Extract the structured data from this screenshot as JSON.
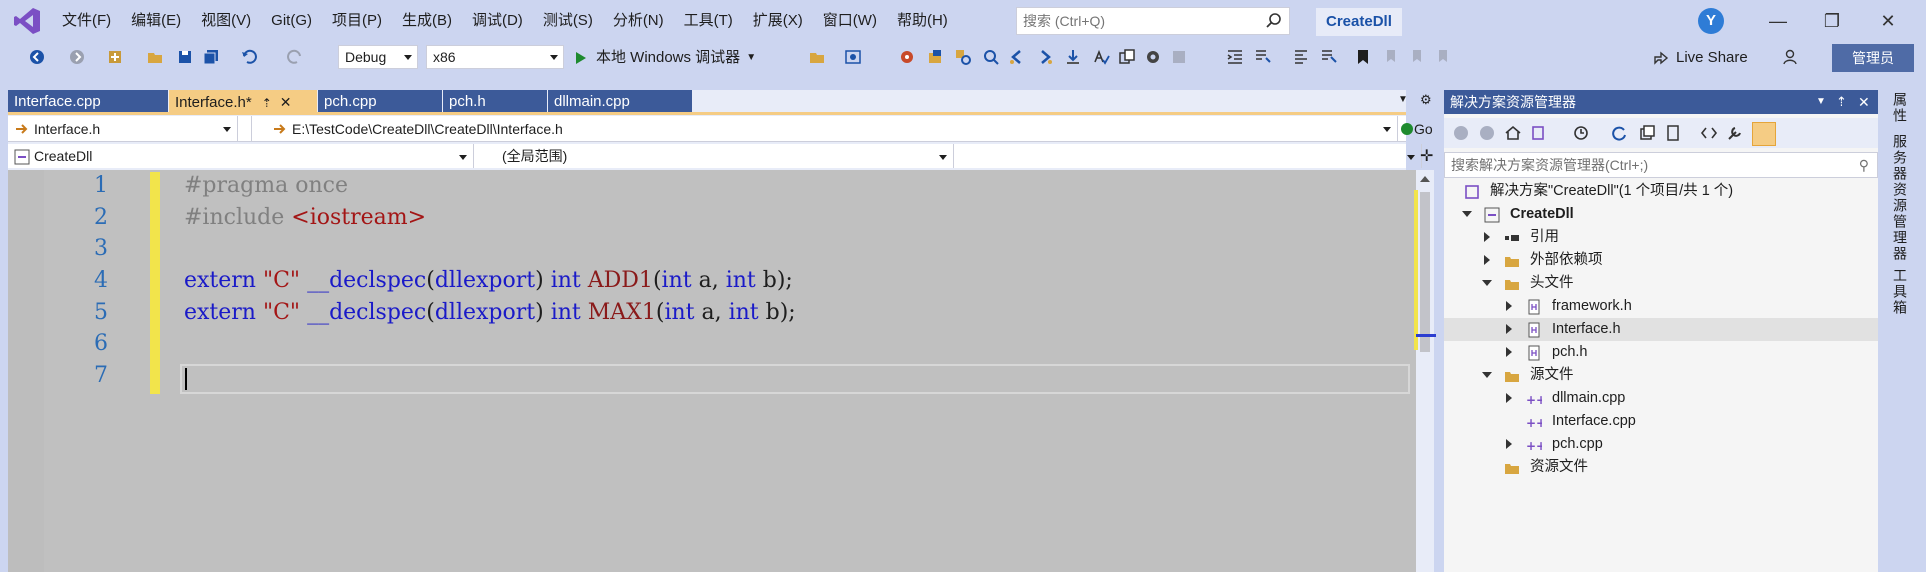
{
  "menu": [
    "文件(F)",
    "编辑(E)",
    "视图(V)",
    "Git(G)",
    "项目(P)",
    "生成(B)",
    "调试(D)",
    "测试(S)",
    "分析(N)",
    "工具(T)",
    "扩展(X)",
    "窗口(W)",
    "帮助(H)"
  ],
  "search": {
    "placeholder": "搜索 (Ctrl+Q)"
  },
  "solution_title": "CreateDll",
  "avatar_letter": "Y",
  "toolbar": {
    "config": "Debug",
    "platform": "x86",
    "debugger": "本地 Windows 调试器",
    "live_share": "Live Share",
    "admin": "管理员"
  },
  "tabs": [
    {
      "label": "Interface.cpp",
      "active": false
    },
    {
      "label": "Interface.h*",
      "active": true
    },
    {
      "label": "pch.cpp",
      "active": false
    },
    {
      "label": "pch.h",
      "active": false
    },
    {
      "label": "dllmain.cpp",
      "active": false
    }
  ],
  "nav": {
    "file": "Interface.h",
    "path": "E:\\TestCode\\CreateDll\\CreateDll\\Interface.h",
    "go": "Go",
    "project": "CreateDll",
    "scope": "(全局范围)"
  },
  "code": {
    "line_numbers": [
      "1",
      "2",
      "3",
      "4",
      "5",
      "6",
      "7"
    ],
    "line1": "#pragma once",
    "line2_pp": "#include",
    "line2_hdr": "<iostream>",
    "line4": {
      "kw1": "extern",
      "str": "\"C\"",
      "kw2": "__declspec",
      "p1": "(",
      "arg": "dllexport",
      "p2": ")",
      "kw3": "int",
      "fn": "ADD1",
      "p3": "(",
      "kw4": "int",
      "a": "a,",
      "kw5": "int",
      "b": "b);"
    },
    "line5": {
      "kw1": "extern",
      "str": "\"C\"",
      "kw2": "__declspec",
      "p1": "(",
      "arg": "dllexport",
      "p2": ")",
      "kw3": "int",
      "fn": "MAX1",
      "p3": "(",
      "kw4": "int",
      "a": "a,",
      "kw5": "int",
      "b": "b);"
    }
  },
  "solution_explorer": {
    "title": "解决方案资源管理器",
    "search_placeholder": "搜索解决方案资源管理器(Ctrl+;)",
    "items": [
      {
        "label": "解决方案\"CreateDll\"(1 个项目/共 1 个)"
      },
      {
        "label": "CreateDll"
      },
      {
        "label": "引用"
      },
      {
        "label": "外部依赖项"
      },
      {
        "label": "头文件"
      },
      {
        "label": "framework.h"
      },
      {
        "label": "Interface.h"
      },
      {
        "label": "pch.h"
      },
      {
        "label": "源文件"
      },
      {
        "label": "dllmain.cpp"
      },
      {
        "label": "Interface.cpp"
      },
      {
        "label": "pch.cpp"
      },
      {
        "label": "资源文件"
      }
    ]
  },
  "rail": [
    "属性",
    "服务器资源管理器",
    "工具箱"
  ],
  "colors": {
    "accent": "#3C5A99",
    "active_tab": "#F5CC84",
    "keyword": "#1A1AC8",
    "string": "#A31515",
    "changebar": "#F2E44B"
  }
}
